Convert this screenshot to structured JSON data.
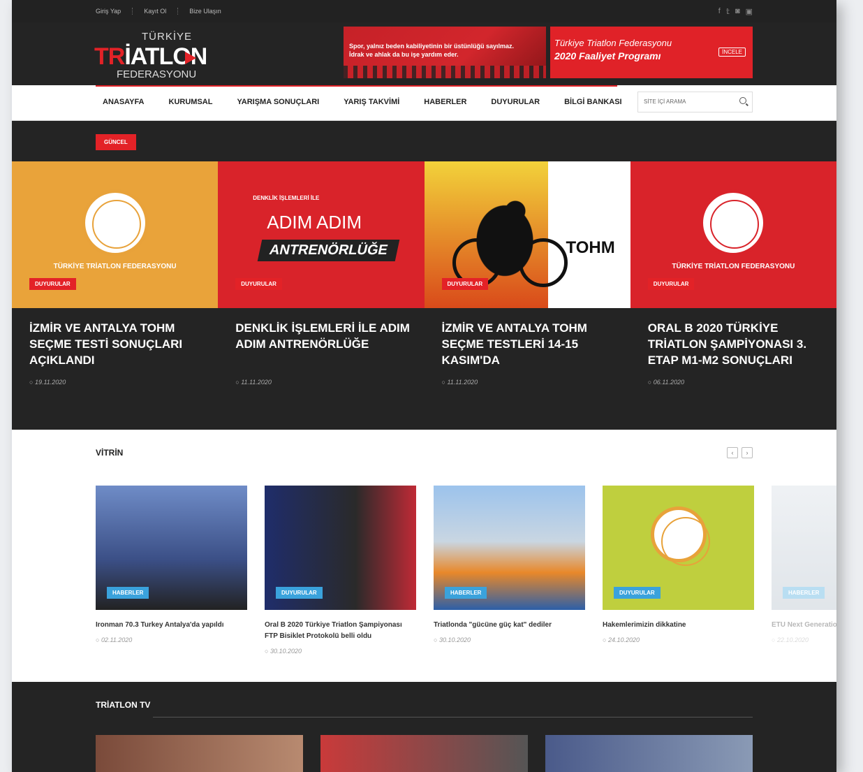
{
  "topbar": {
    "links": [
      "Giriş Yap",
      "Kayıt Ol",
      "Bize Ulaşın"
    ],
    "social_icons": [
      "facebook-icon",
      "twitter-icon",
      "instagram-icon",
      "youtube-icon"
    ]
  },
  "logo": {
    "line1": "TÜRKİYE",
    "line2a": "TR",
    "line2b": "İATLON",
    "line3": "FEDERASYONU"
  },
  "banner1": {
    "text": "Spor, yalnız beden kabiliyetinin bir üstünlüğü sayılmaz. İdrak ve ahlak da bu işe yardım eder."
  },
  "banner2": {
    "line1": "Türkiye Triatlon Federasyonu",
    "line2": "2020 Faaliyet Programı",
    "button": "İNCELE"
  },
  "nav": {
    "items": [
      "ANASAYFA",
      "KURUMSAL",
      "YARIŞMA SONUÇLARI",
      "YARIŞ TAKVİMİ",
      "HABERLER",
      "DUYURULAR",
      "BİLGİ BANKASI"
    ],
    "search_placeholder": "SİTE İÇİ ARAMA"
  },
  "current": {
    "label": "GÜNCEL",
    "slides": [
      {
        "tag": "DUYURULAR",
        "title": "İZMİR VE ANTALYA TOHM SEÇME TESTİ SONUÇLARI AÇIKLANDI",
        "date": "19.11.2020",
        "img_text": "TÜRKİYE TRİATLON FEDERASYONU",
        "bg": "#e9a33a"
      },
      {
        "tag": "DUYURULAR",
        "title": "DENKLİK İŞLEMLERİ İLE ADIM ADIM ANTRENÖRLÜĞE",
        "date": "11.11.2020",
        "img_text1": "DENKLİK İŞLEMLERİ İLE",
        "img_text2": "ADIM ADIM",
        "img_text3": "ANTRENÖRLÜĞE",
        "bg": "#d9232a"
      },
      {
        "tag": "DUYURULAR",
        "title": "İZMİR VE ANTALYA TOHM SEÇME TESTLERİ 14-15 KASIM'DA",
        "date": "11.11.2020",
        "img_text": "TOHM",
        "bg": "#f0c21a"
      },
      {
        "tag": "DUYURULAR",
        "title": "ORAL B 2020 TÜRKİYE TRİATLON ŞAMPİYONASI 3. ETAP M1-M2 SONUÇLARI",
        "date": "06.11.2020",
        "img_text": "TÜRKİYE TRİATLON FEDERASYONU",
        "bg": "#d9232a"
      }
    ]
  },
  "vitrin": {
    "title": "VİTRİN",
    "cards": [
      {
        "tag": "HABERLER",
        "title": "Ironman 70.3 Turkey Antalya'da yapıldı",
        "date": "02.11.2020",
        "bg": "#3b4f86"
      },
      {
        "tag": "DUYURULAR",
        "title": "Oral B 2020 Türkiye Triatlon Şampiyonası FTP Bisiklet Protokolü belli oldu",
        "date": "30.10.2020",
        "bg": "#1f2d6b"
      },
      {
        "tag": "HABERLER",
        "title": "Triatlonda \"gücüne güç kat\" dediler",
        "date": "30.10.2020",
        "bg": "#6aa0d8"
      },
      {
        "tag": "DUYURULAR",
        "title": "Hakemlerimizin dikkatine",
        "date": "24.10.2020",
        "bg": "#bfcf3e"
      },
      {
        "tag": "HABERLER",
        "title": "ETU Next Generation katılım Türkiye'den",
        "date": "22.10.2020",
        "bg": "#aab7c4"
      }
    ]
  },
  "tv": {
    "title": "TRİATLON TV"
  }
}
